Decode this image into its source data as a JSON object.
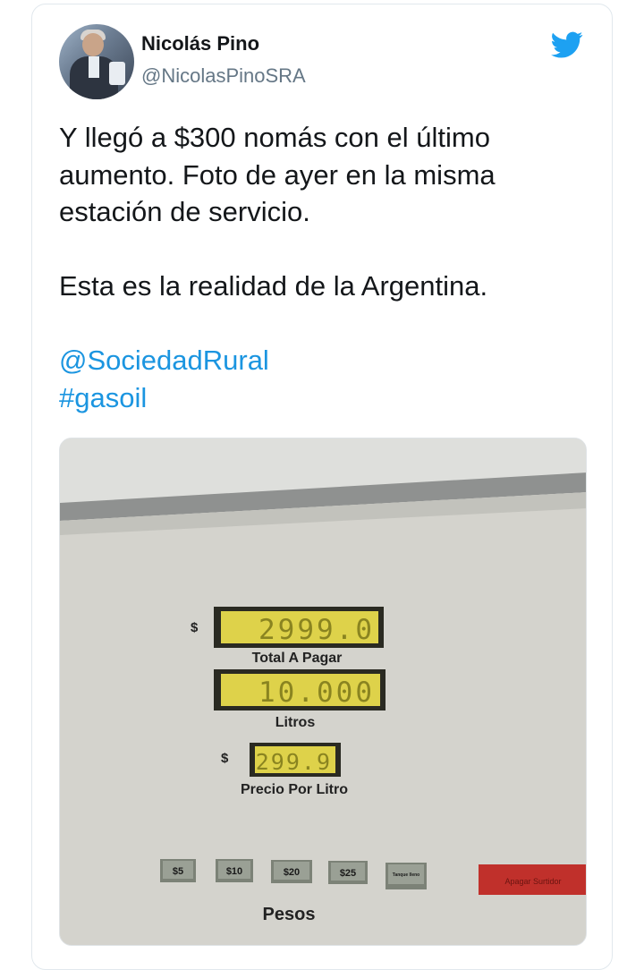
{
  "tweet": {
    "author_name": "Nicolás Pino",
    "author_handle": "@NicolasPinoSRA",
    "text_lines": [
      "Y llegó a $300 nomás con el último",
      "aumento. Foto de ayer en la misma",
      "estación de servicio."
    ],
    "line_2": "Esta es la realidad de la Argentina.",
    "mention": "@SociedadRural",
    "hashtag": "#gasoil"
  },
  "photo": {
    "total_display": "2999.0",
    "total_currency": "$",
    "total_label": "Total A Pagar",
    "liters_display": "10.000",
    "liters_label": "Litros",
    "price_display": "299.9",
    "price_currency": "$",
    "price_label": "Precio Por Litro",
    "preset_buttons": [
      "$5",
      "$10",
      "$20",
      "$25",
      "Tanque lleno"
    ],
    "pesos_label": "Pesos",
    "stop_button": "Apagar Surtidor"
  },
  "icons": {
    "brand": "twitter-bird-icon",
    "brand_color": "#1da1f2"
  }
}
